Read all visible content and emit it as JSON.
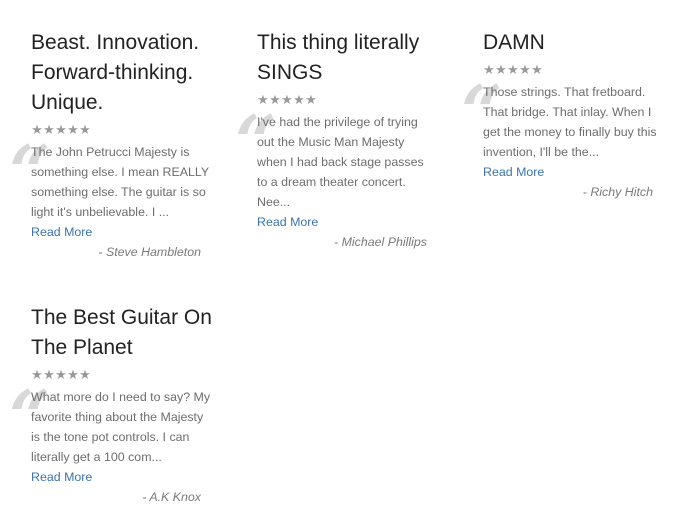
{
  "reviews": [
    {
      "title": "Beast. Innovation. Forward-thinking. Unique.",
      "stars": 5,
      "excerpt": "The John Petrucci Majesty is something else. I mean REALLY something else. The guitar is so light it's unbelievable. I ...",
      "read_more": "Read More",
      "author": "- Steve Hambleton"
    },
    {
      "title": "This thing literally SINGS",
      "stars": 5,
      "excerpt": "I've had the privilege of trying out the Music Man Majesty when I had back stage passes to a dream theater concert. Nee...",
      "read_more": "Read More",
      "author": "- Michael Phillips"
    },
    {
      "title": "DAMN",
      "stars": 5,
      "excerpt": "Those strings. That fretboard. That bridge. That inlay. When I get the money to finally buy this invention, I'll be the...",
      "read_more": "Read More",
      "author": "- Richy Hitch"
    },
    {
      "title": "The Best Guitar On The Planet",
      "stars": 5,
      "excerpt": "What more do I need to say? My favorite thing about the Majesty is the tone pot controls. I can literally get a 100 com...",
      "read_more": "Read More",
      "author": "- A.K Knox"
    }
  ],
  "star_glyph": "★",
  "colors": {
    "title": "#222222",
    "text": "#6d6d6d",
    "link": "#3b74ab",
    "star": "#9a9a9a",
    "quote": "#d8d8d8"
  },
  "icons": {
    "star": "star-icon",
    "quote": "quote-mark-icon"
  }
}
